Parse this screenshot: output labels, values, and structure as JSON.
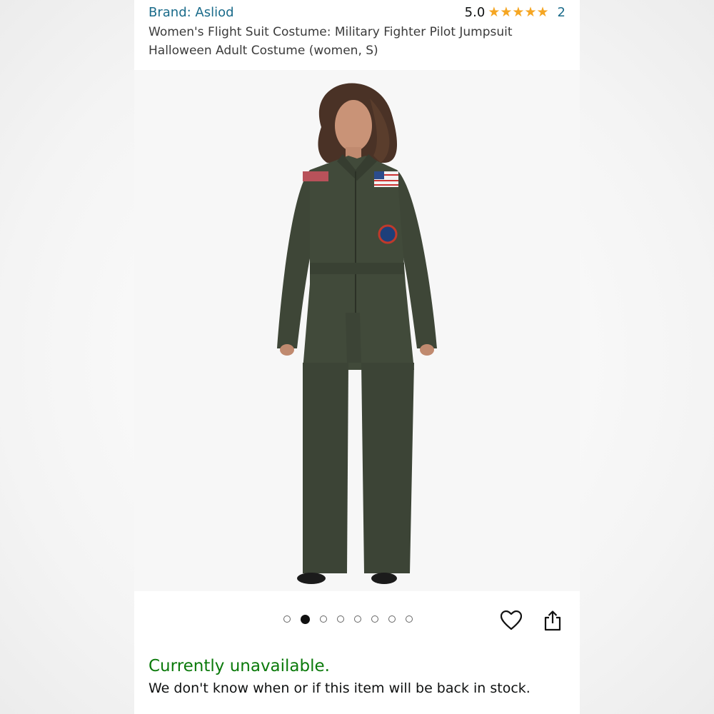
{
  "brand": {
    "text": "Brand: Asliod"
  },
  "rating": {
    "score": "5.0",
    "stars": 5,
    "count": "2"
  },
  "product": {
    "title_line1": "Women's Flight Suit Costume: Military Fighter Pilot Jumpsuit",
    "title_line2": "Halloween Adult Costume (women, S)"
  },
  "gallery": {
    "image_count": 8,
    "active_index": 1
  },
  "actions": {
    "wishlist_icon": "heart-icon",
    "share_icon": "share-icon"
  },
  "availability": {
    "status": "Currently unavailable.",
    "message": "We don't know when or if this item will be back in stock."
  },
  "colors": {
    "brand_link": "#1a6b8a",
    "star": "#f5a623",
    "available_status": "#0b7a0b",
    "suit": "#3e4637"
  }
}
